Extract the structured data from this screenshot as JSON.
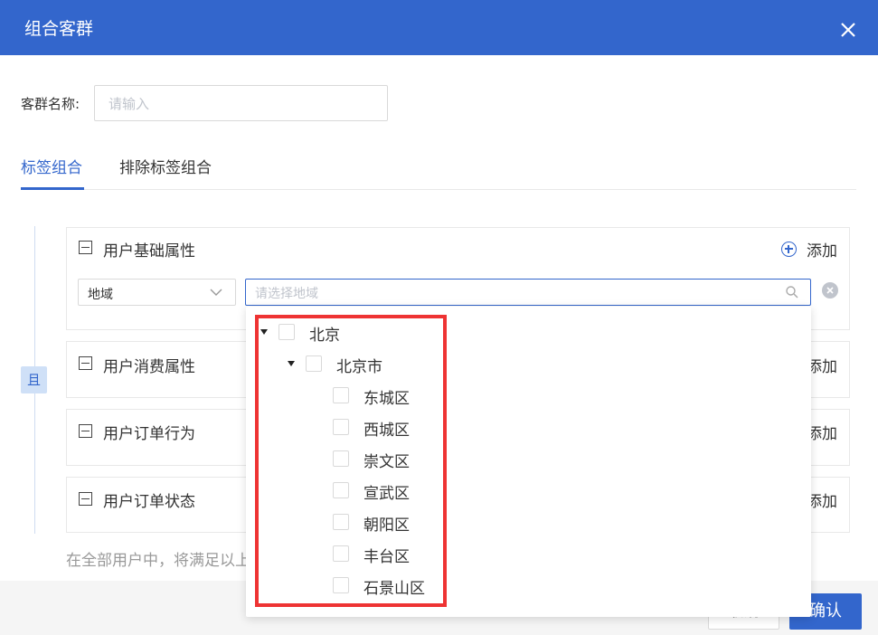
{
  "dialog": {
    "title": "组合客群"
  },
  "name_field": {
    "label": "客群名称:",
    "placeholder": "请输入"
  },
  "tabs": [
    {
      "label": "标签组合",
      "active": true
    },
    {
      "label": "排除标签组合",
      "active": false
    }
  ],
  "logic_badge": "且",
  "groups": [
    {
      "title": "用户基础属性",
      "add_label": "添加"
    },
    {
      "title": "用户消费属性",
      "add_label": "添加"
    },
    {
      "title": "用户订单行为",
      "add_label": "添加"
    },
    {
      "title": "用户订单状态",
      "add_label": "添加"
    }
  ],
  "filter": {
    "attribute": "地域",
    "region_placeholder": "请选择地域"
  },
  "tree": {
    "province": "北京",
    "city": "北京市",
    "districts": [
      "东城区",
      "西城区",
      "崇文区",
      "宣武区",
      "朝阳区",
      "丰台区",
      "石景山区"
    ]
  },
  "note_text": "在全部用户中，将满足以上",
  "footer": {
    "cancel_label": "取消",
    "confirm_label": "确认"
  },
  "colors": {
    "primary": "#3366cc",
    "highlight": "#ee3333"
  }
}
